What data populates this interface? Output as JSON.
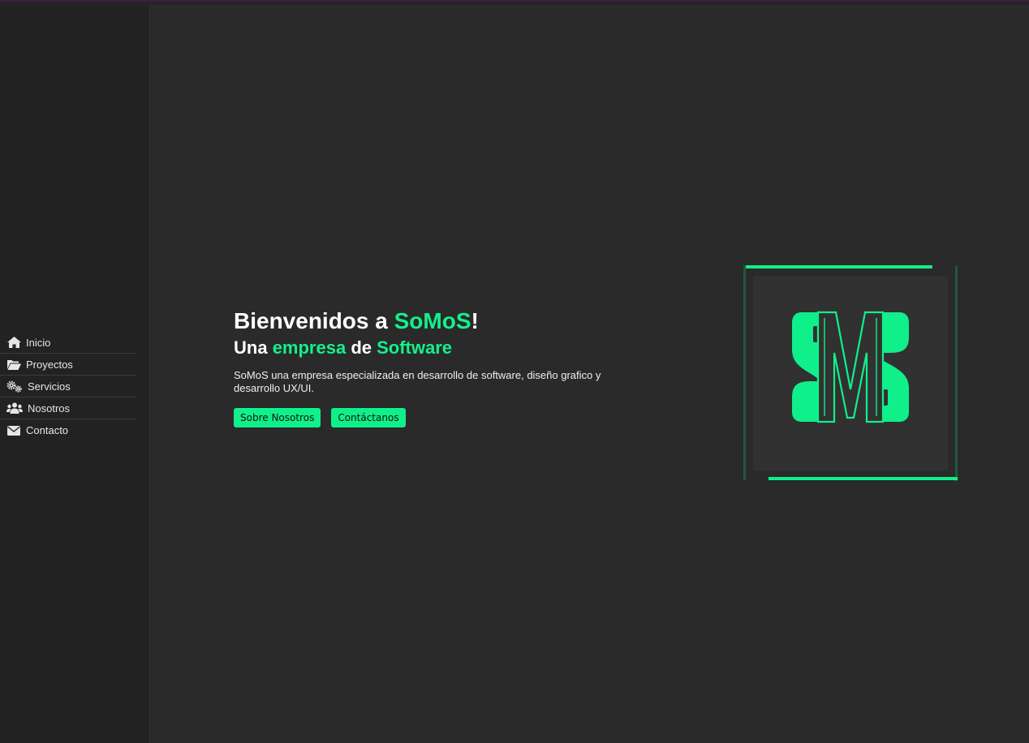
{
  "colors": {
    "accent": "#0ff08a",
    "background": "#2a2a2a",
    "sidebar": "#222222"
  },
  "sidebar": {
    "items": [
      {
        "label": "Inicio",
        "icon": "home-icon"
      },
      {
        "label": "Proyectos",
        "icon": "folder-open-icon"
      },
      {
        "label": "Servicios",
        "icon": "gears-icon"
      },
      {
        "label": "Nosotros",
        "icon": "users-icon"
      },
      {
        "label": "Contacto",
        "icon": "envelope-icon"
      }
    ]
  },
  "hero": {
    "title_prefix": "Bienvenidos a ",
    "title_brand": "SoMoS",
    "title_suffix": "!",
    "subtitle_part1": "Una ",
    "subtitle_part2": "empresa",
    "subtitle_part3": " de ",
    "subtitle_part4": "Software",
    "description": "SoMoS una empresa especializada en desarrollo de software, diseño grafico y desarrollo UX/UI.",
    "about_button": "Sobre Nosotros",
    "contact_button": "Contáctanos"
  },
  "logo": {
    "icon": "somos-logo-icon"
  }
}
